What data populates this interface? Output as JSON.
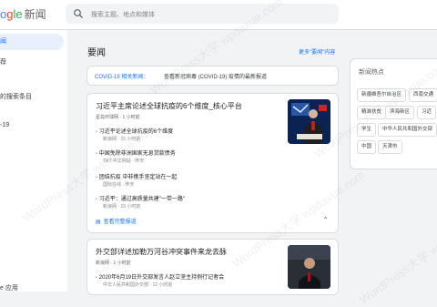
{
  "header": {
    "logo_part1": "o",
    "logo_part2": "g",
    "logo_part3": "le",
    "logo_news": "新闻",
    "search_placeholder": "搜索主题、地点和媒体"
  },
  "sidebar": {
    "items": [
      {
        "label": "闻"
      },
      {
        "label": "荐"
      },
      {
        "label": "的搜索条目"
      },
      {
        "label": "-19"
      },
      {
        "label": "e 应用"
      }
    ]
  },
  "main": {
    "title": "要闻",
    "more_link": "更多\"要闻\"内容",
    "covid_label": "COVID-19 相关新闻：",
    "covid_text": "查看新冠病毒 (COVID-19) 疫情的最新报道",
    "story1": {
      "headline": "习近平主席论述全球抗疫的6个维度_核心平台",
      "source": "星岛环球网 · 1 小时前",
      "related": [
        {
          "title": "习近平论述全球抗疫的6个维度",
          "source": "新浪网 · 15 小时前"
        },
        {
          "title": "中国免除非洲国家无息贷款债务",
          "source": "TRT 中文网站 · 昨天"
        },
        {
          "title": "团结抗疫 中非携手坚定站在一起",
          "source": "国际在线 · 昨天"
        },
        {
          "title": "习近平：通过高质量共建\"一带一路\"",
          "source": "新浪网 · 15 小时前"
        }
      ],
      "coverage": "查看完整报道"
    },
    "story2": {
      "headline": "外交部详述加勒万河谷冲突事件来龙去脉",
      "source": "新浪网 · 1 小时前",
      "related": [
        {
          "title": "2020年6月19日外交部发言人赵立坚主持例行记者会",
          "source": "中华人民共和国外交部 · 12 小时前"
        }
      ]
    }
  },
  "right_panel": {
    "title": "新闻热点",
    "chips": [
      "新疆维吾尔自治区",
      "西南交通",
      "精准扶贫",
      "滨海新区",
      "习近",
      "学生",
      "中华人民共和国外交部",
      "中国",
      "天津市"
    ]
  },
  "colors": {
    "accent": "#1a73e8",
    "background": "#f1f3f4"
  },
  "icons": [
    "search-icon",
    "newspaper-icon",
    "chevron-down-icon"
  ],
  "watermark": "WordPress大学 wpdaxue.com"
}
